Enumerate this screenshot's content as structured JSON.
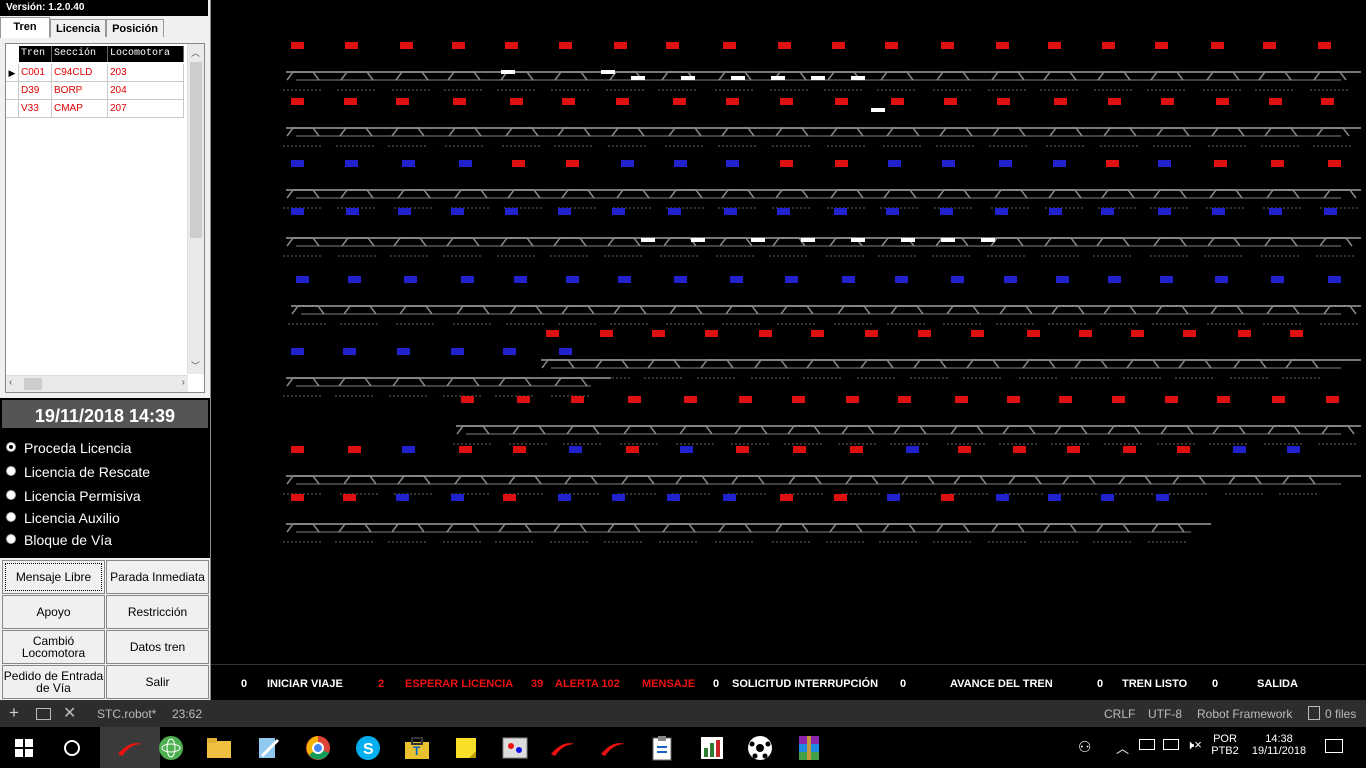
{
  "app": {
    "version": "Versión: 1.2.0.40"
  },
  "tabs": [
    {
      "label": "Tren"
    },
    {
      "label": "Licencia"
    },
    {
      "label": "Posición"
    }
  ],
  "grid": {
    "headers": [
      "Tren",
      "Sección",
      "Locomotora"
    ],
    "rows": [
      {
        "tren": "C001",
        "seccion": "C94CLD",
        "locomotora": "203"
      },
      {
        "tren": "D39",
        "seccion": "BORP",
        "locomotora": "204"
      },
      {
        "tren": "V33",
        "seccion": "CMAP",
        "locomotora": "207"
      }
    ]
  },
  "clock": "19/11/2018 14:39",
  "licencia_options": [
    {
      "label": "Proceda Licencia",
      "selected": true
    },
    {
      "label": "Licencia de Rescate",
      "selected": false
    },
    {
      "label": "Licencia Permisiva",
      "selected": false
    },
    {
      "label": "Licencia Auxilio",
      "selected": false
    },
    {
      "label": "Bloque de Vía",
      "selected": false
    }
  ],
  "buttons": {
    "mensaje_libre": "Mensaje Libre",
    "parada_inmediata": "Parada Inmediata",
    "apoyo": "Apoyo",
    "restriccion": "Restricción",
    "cambio_locomotora": "Cambió Locomotora",
    "datos_tren": "Datos tren",
    "pedido_entrada": "Pedido de Entrada de Vía",
    "salir": "Salir"
  },
  "status": {
    "iniciar_count": "0",
    "iniciar_label": "INICIAR VIAJE",
    "esperar_count": "2",
    "esperar_label": "ESPERAR LICENCIA",
    "alerta_count": "39",
    "alerta_label": "ALERTA 102",
    "mensaje_label": "MENSAJE",
    "solicitud_count": "0",
    "solicitud_label": "SOLICITUD INTERRUPCIÓN",
    "avance_count": "0",
    "avance_label": "AVANCE DEL TREN",
    "listo_count": "0",
    "listo_label": "TREN LISTO",
    "salida_count": "0",
    "salida_label": "SALIDA",
    "colors": {
      "normal": "#ffffff",
      "alert": "#ee1111"
    }
  },
  "editor_bar": {
    "file": "STC.robot*",
    "position": "23:62",
    "eol": "CRLF",
    "encoding": "UTF-8",
    "language": "Robot Framework",
    "files": "0 files"
  },
  "taskbar": {
    "icons": [
      "windows-start",
      "search-circle",
      "app-red-swoosh",
      "atom-green",
      "file-explorer",
      "notepad-pen",
      "chrome",
      "skype",
      "toolbox",
      "sticky-notes",
      "paint-app",
      "app-red-swoosh-2",
      "app-red-swoosh-3",
      "clipboard-app",
      "chart-app",
      "soccer-app",
      "winrar"
    ],
    "lang_top": "POR",
    "lang_bottom": "PTB2",
    "time": "14:38",
    "date": "19/11/2018"
  }
}
